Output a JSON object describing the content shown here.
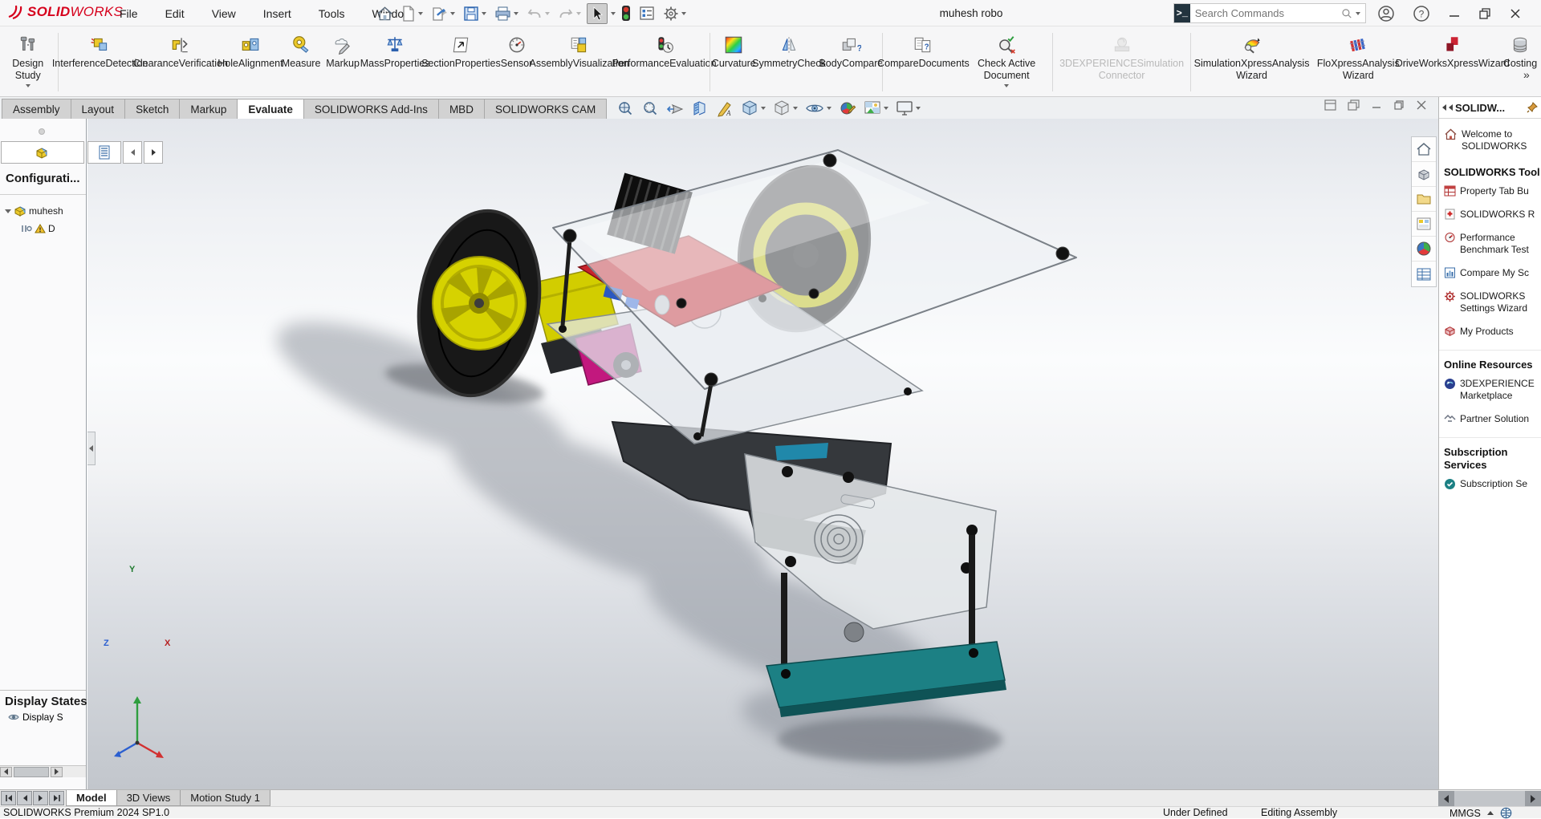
{
  "colors": {
    "logo_red": "#d6001c",
    "tab_active_bg": "#ffffff",
    "tab_inactive_bg": "#d2d2d2",
    "viewport_top": "#e3e6eb",
    "viewport_bottom": "#c2c6cc",
    "teal_plate": "#17787b",
    "pcb_red": "#c8242c",
    "wheel_yellow": "#d8d300",
    "motor_magenta": "#c2187e",
    "chassis_dark": "#33363a",
    "accent_blue": "#1f86a8"
  },
  "titlebar": {
    "logo_solid": "SOLID",
    "logo_works": "WORKS",
    "menus": [
      "File",
      "Edit",
      "View",
      "Insert",
      "Tools",
      "Window"
    ],
    "document_title": "muhesh robo",
    "search_placeholder": "Search Commands"
  },
  "ribbon": {
    "overflow": "»",
    "items": [
      {
        "line1": "Design Study",
        "line2": ""
      },
      {
        "line1": "Interference",
        "line2": "Detection"
      },
      {
        "line1": "Clearance",
        "line2": "Verification"
      },
      {
        "line1": "Hole",
        "line2": "Alignment"
      },
      {
        "line1": "Measure",
        "line2": ""
      },
      {
        "line1": "Markup",
        "line2": ""
      },
      {
        "line1": "Mass",
        "line2": "Properties"
      },
      {
        "line1": "Section",
        "line2": "Properties"
      },
      {
        "line1": "Sensor",
        "line2": ""
      },
      {
        "line1": "Assembly",
        "line2": "Visualization"
      },
      {
        "line1": "Performance",
        "line2": "Evaluation"
      },
      {
        "line1": "Curvature",
        "line2": ""
      },
      {
        "line1": "Symmetry",
        "line2": "Check"
      },
      {
        "line1": "Body",
        "line2": "Compare"
      },
      {
        "line1": "Compare",
        "line2": "Documents"
      },
      {
        "line1": "Check Active Document",
        "line2": ""
      },
      {
        "line1": "3DEXPERIENCE",
        "line2": "Simulation Connector"
      },
      {
        "line1": "SimulationXpress",
        "line2": "Analysis Wizard"
      },
      {
        "line1": "FloXpress",
        "line2": "Analysis Wizard"
      },
      {
        "line1": "DriveWorksXpress",
        "line2": "Wizard"
      },
      {
        "line1": "Costing",
        "line2": ""
      }
    ]
  },
  "command_tabs": {
    "tabs": [
      {
        "label": "Assembly"
      },
      {
        "label": "Layout"
      },
      {
        "label": "Sketch"
      },
      {
        "label": "Markup"
      },
      {
        "label": "Evaluate"
      },
      {
        "label": "SOLIDWORKS Add-Ins"
      },
      {
        "label": "MBD"
      },
      {
        "label": "SOLIDWORKS CAM"
      }
    ]
  },
  "left_panel": {
    "configurations_label": "Configurati...",
    "tree_root": "muhesh",
    "tree_child": "D",
    "display_states_label": "Display States",
    "display_state_item": "Display S"
  },
  "viewport": {
    "triad": {
      "x": "X",
      "y": "Y",
      "z": "Z"
    }
  },
  "task_pane": {
    "header": "SOLIDW...",
    "welcome": "Welcome to SOLIDWORKS",
    "tools_header": "SOLIDWORKS Tool",
    "tools_items": [
      "Property Tab Bu",
      "SOLIDWORKS R",
      "Performance Benchmark Test",
      "Compare My Sc",
      "SOLIDWORKS Settings Wizard",
      "My Products"
    ],
    "online_header": "Online Resources",
    "online_items": [
      "3DEXPERIENCE Marketplace",
      "Partner Solution"
    ],
    "subscription_header": "Subscription Services",
    "subscription_items": [
      "Subscription Se"
    ]
  },
  "bottom_bar": {
    "tabs": [
      {
        "label": "Model"
      },
      {
        "label": "3D Views"
      },
      {
        "label": "Motion Study 1"
      }
    ]
  },
  "status_bar": {
    "left": "SOLIDWORKS Premium 2024 SP1.0",
    "status": "Under Defined",
    "mode": "Editing Assembly",
    "units": "MMGS"
  }
}
